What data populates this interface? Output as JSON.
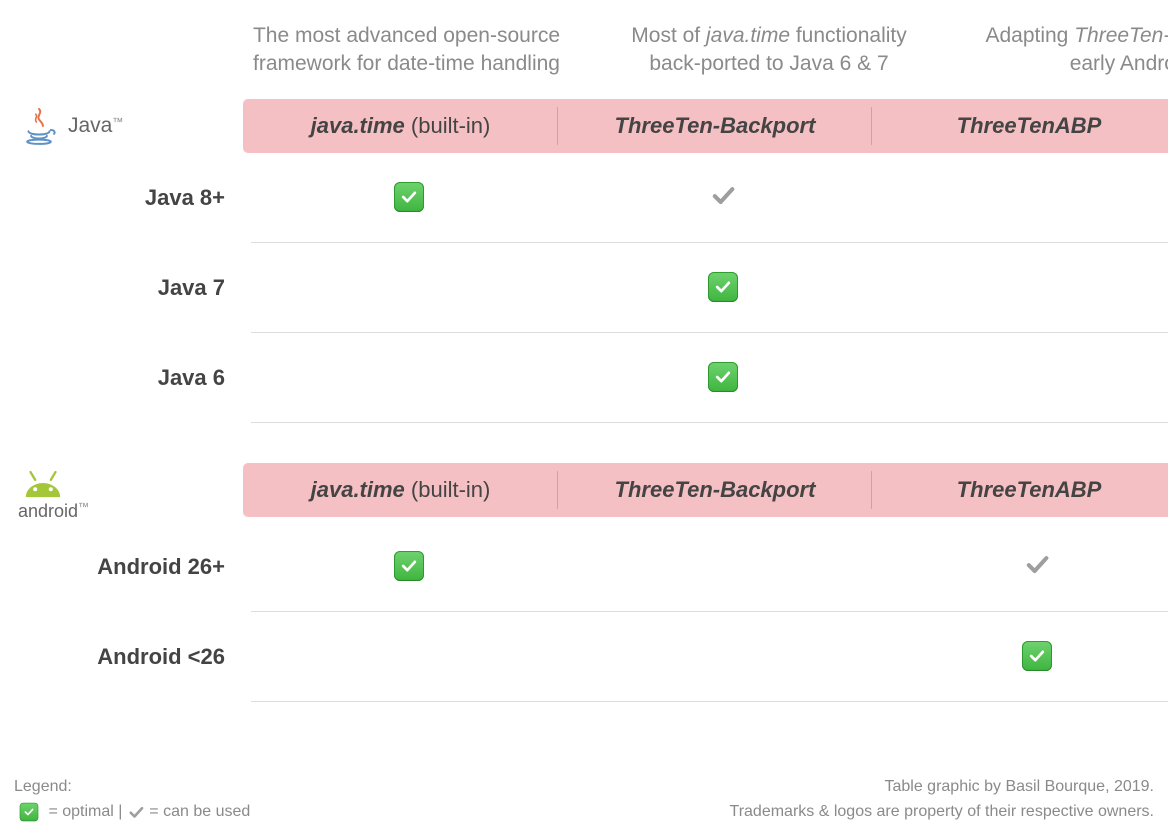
{
  "descriptions": {
    "javatime": "The most advanced open-source framework for date-time handling",
    "backport_prefix": "Most of ",
    "backport_italic": "java.time",
    "backport_suffix": " functionality back-ported to Java 6 & 7",
    "abp_prefix": "Adapting ",
    "abp_italic": "ThreeTen-Backport",
    "abp_suffix": " to early Android"
  },
  "platforms": {
    "java_label": "Java",
    "java_tm": "™",
    "android_label": "android",
    "android_tm": "™"
  },
  "columns": {
    "col1_italic": "java.time",
    "col1_suffix": " (built-in)",
    "col2": "ThreeTen-Backport",
    "col3": "ThreeTenABP"
  },
  "rows": {
    "java8": "Java 8+",
    "java7": "Java 7",
    "java6": "Java 6",
    "android26": "Android 26+",
    "androidLt26": "Android <26"
  },
  "legend": {
    "title": "Legend:",
    "optimal": " = optimal",
    "divider": "   |  ",
    "canbeused": " = can be used"
  },
  "credits": {
    "line1": "Table graphic by Basil Bourque, 2019.",
    "line2": "Trademarks & logos are property of their respective owners."
  },
  "chart_data": {
    "type": "table",
    "columns": [
      "java.time (built-in)",
      "ThreeTen-Backport",
      "ThreeTenABP"
    ],
    "column_descriptions": [
      "The most advanced open-source framework for date-time handling",
      "Most of java.time functionality back-ported to Java 6 & 7",
      "Adapting ThreeTen-Backport to early Android"
    ],
    "groups": [
      {
        "platform": "Java",
        "rows": [
          {
            "label": "Java 8+",
            "cells": [
              "optimal",
              "can-be-used",
              ""
            ]
          },
          {
            "label": "Java 7",
            "cells": [
              "",
              "optimal",
              ""
            ]
          },
          {
            "label": "Java 6",
            "cells": [
              "",
              "optimal",
              ""
            ]
          }
        ]
      },
      {
        "platform": "Android",
        "rows": [
          {
            "label": "Android 26+",
            "cells": [
              "optimal",
              "",
              "can-be-used"
            ]
          },
          {
            "label": "Android <26",
            "cells": [
              "",
              "",
              "optimal"
            ]
          }
        ]
      }
    ],
    "legend": {
      "optimal": "✅ = optimal",
      "can_be_used": "✔ = can be used"
    }
  }
}
